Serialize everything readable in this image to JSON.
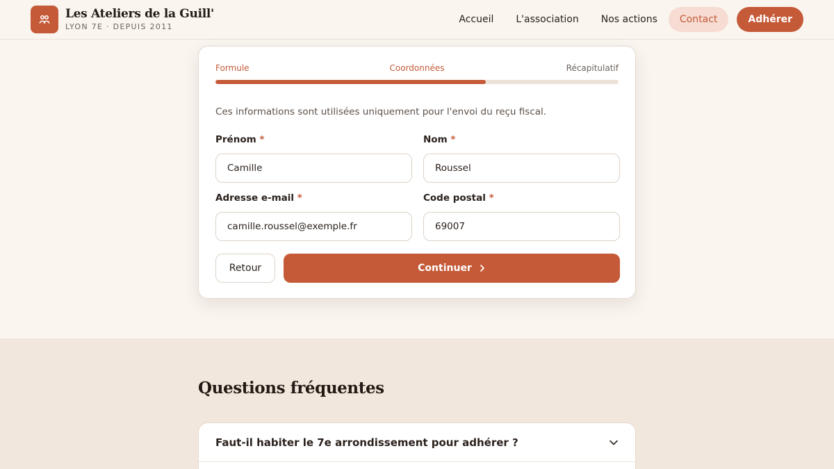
{
  "brand": {
    "title": "Les Ateliers de la Guill'",
    "subtitle": "LYON 7E · DEPUIS 2011",
    "icon": "people-icon"
  },
  "nav": {
    "items": [
      {
        "label": "Accueil"
      },
      {
        "label": "L'association"
      },
      {
        "label": "Nos actions"
      },
      {
        "label": "Contact",
        "active": true
      }
    ],
    "cta_label": "Adhérer"
  },
  "form": {
    "steps": [
      {
        "label": "Formule",
        "state": "done"
      },
      {
        "label": "Coordonnées",
        "state": "current"
      },
      {
        "label": "Récapitulatif",
        "state": "todo"
      }
    ],
    "progress_percent": 67,
    "intro": "Ces informations sont utilisées uniquement pour l'envoi du reçu fiscal.",
    "required_marker": "*",
    "fields": {
      "firstname": {
        "label": "Prénom",
        "value": "Camille"
      },
      "lastname": {
        "label": "Nom",
        "value": "Roussel"
      },
      "email": {
        "label": "Adresse e-mail",
        "value": "camille.roussel@exemple.fr"
      },
      "postal": {
        "label": "Code postal",
        "value": "69007"
      }
    },
    "back_label": "Retour",
    "continue_label": "Continuer"
  },
  "faq": {
    "title": "Questions fréquentes",
    "items": [
      {
        "question": "Faut-il habiter le 7e arrondissement pour adhérer ?"
      }
    ]
  },
  "colors": {
    "accent": "#c55a38",
    "accent_soft": "#f6dcd3",
    "background": "#faf5ef",
    "section_background": "#f2e7dc"
  }
}
